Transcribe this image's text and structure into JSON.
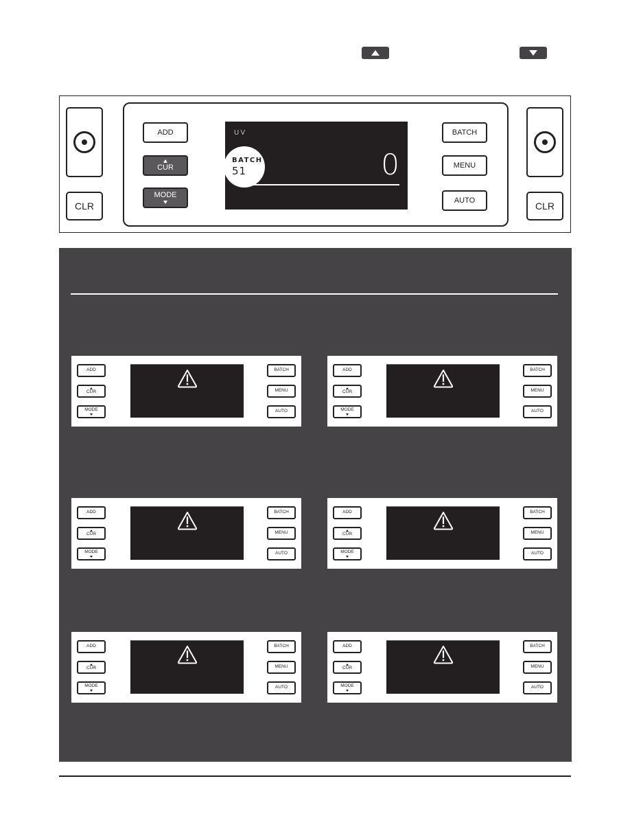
{
  "header": {
    "up_key_icon": "triangle-up",
    "down_key_icon": "triangle-down"
  },
  "control_panel": {
    "left_dial_icon": "dial",
    "right_dial_icon": "dial",
    "left_clr": "CLR",
    "right_clr": "CLR",
    "buttons_left": [
      {
        "label": "ADD",
        "style": "light"
      },
      {
        "label": "CUR",
        "arrow": "up",
        "style": "dark"
      },
      {
        "label": "MODE",
        "arrow": "down",
        "style": "dark"
      }
    ],
    "buttons_right": [
      {
        "label": "BATCH"
      },
      {
        "label": "MENU"
      },
      {
        "label": "AUTO"
      }
    ],
    "display": {
      "mode_label": "UV",
      "count": "0",
      "batch_label": "BATCH",
      "batch_value": "51"
    }
  },
  "error_panels": [
    {
      "buttons_left": [
        "ADD",
        "CUR",
        "MODE"
      ],
      "buttons_right": [
        "BATCH",
        "MENU",
        "AUTO"
      ],
      "icon": "warning-triangle"
    },
    {
      "buttons_left": [
        "ADD",
        "CUR",
        "MODE"
      ],
      "buttons_right": [
        "BATCH",
        "MENU",
        "AUTO"
      ],
      "icon": "warning-triangle"
    },
    {
      "buttons_left": [
        "ADD",
        "CUR",
        "MODE"
      ],
      "buttons_right": [
        "BATCH",
        "MENU",
        "AUTO"
      ],
      "icon": "warning-triangle"
    },
    {
      "buttons_left": [
        "ADD",
        "CUR",
        "MODE"
      ],
      "buttons_right": [
        "BATCH",
        "MENU",
        "AUTO"
      ],
      "icon": "warning-triangle"
    },
    {
      "buttons_left": [
        "ADD",
        "CUR",
        "MODE"
      ],
      "buttons_right": [
        "BATCH",
        "MENU",
        "AUTO"
      ],
      "icon": "warning-triangle"
    },
    {
      "buttons_left": [
        "ADD",
        "CUR",
        "MODE"
      ],
      "buttons_right": [
        "BATCH",
        "MENU",
        "AUTO"
      ],
      "icon": "warning-triangle"
    }
  ],
  "colors": {
    "section_bg": "#454345",
    "lcd_bg": "#231f20",
    "dark_button": "#5a585a"
  }
}
